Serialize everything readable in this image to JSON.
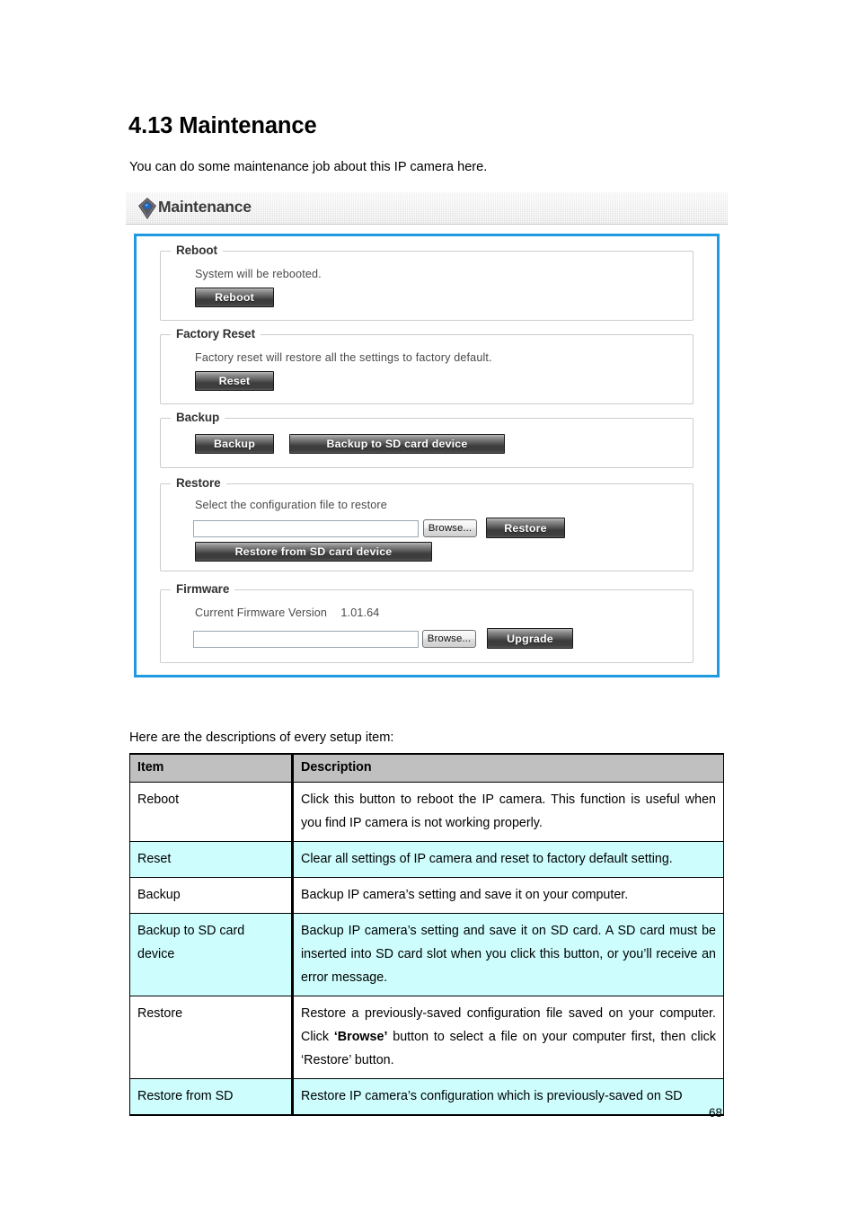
{
  "document": {
    "section_number_heading": "4.13 Maintenance",
    "intro": "You can do some maintenance job about this IP camera here.",
    "table_intro": "Here are the descriptions of every setup item:",
    "page_number": "68"
  },
  "panel": {
    "title": "Maintenance",
    "icon": "gem-diamond-icon",
    "border_color": "#1f9ae0",
    "groups": {
      "reboot": {
        "legend": "Reboot",
        "text": "System will be rebooted.",
        "button": "Reboot"
      },
      "factory_reset": {
        "legend": "Factory Reset",
        "text": "Factory reset will restore all the settings to factory default.",
        "button": "Reset"
      },
      "backup": {
        "legend": "Backup",
        "button_local": "Backup",
        "button_sd": "Backup to SD card device"
      },
      "restore": {
        "legend": "Restore",
        "text": "Select the configuration file to restore",
        "file_value": "",
        "browse_button": "Browse...",
        "restore_button": "Restore",
        "button_sd": "Restore from SD card device"
      },
      "firmware": {
        "legend": "Firmware",
        "version_label": "Current Firmware Version",
        "version_value": "1.01.64",
        "file_value": "",
        "browse_button": "Browse...",
        "upgrade_button": "Upgrade"
      }
    }
  },
  "table": {
    "headers": [
      "Item",
      "Description"
    ],
    "rows": [
      {
        "item": "Reboot",
        "description": "Click this button to reboot the IP camera. This function is useful when you find IP camera is not working properly.",
        "highlight": false
      },
      {
        "item": "Reset",
        "description": "Clear all settings of IP camera and reset to factory default setting.",
        "highlight": true
      },
      {
        "item": "Backup",
        "description": "Backup IP camera’s setting and save it on your computer.",
        "highlight": false
      },
      {
        "item": "Backup to SD card device",
        "description": "Backup IP camera’s setting and save it on SD card. A SD card must be inserted into SD card slot when you click this button, or you’ll receive an error message.",
        "highlight": true
      },
      {
        "item": "Restore",
        "description_pre": "Restore a previously-saved configuration file saved on your computer. Click ",
        "description_bold": "‘Browse’",
        "description_post": " button to select a file on your computer first, then click ‘Restore’ button.",
        "highlight": false
      },
      {
        "item": "Restore from SD",
        "description": "Restore IP camera’s configuration which is previously-saved on SD",
        "highlight": true
      }
    ]
  }
}
